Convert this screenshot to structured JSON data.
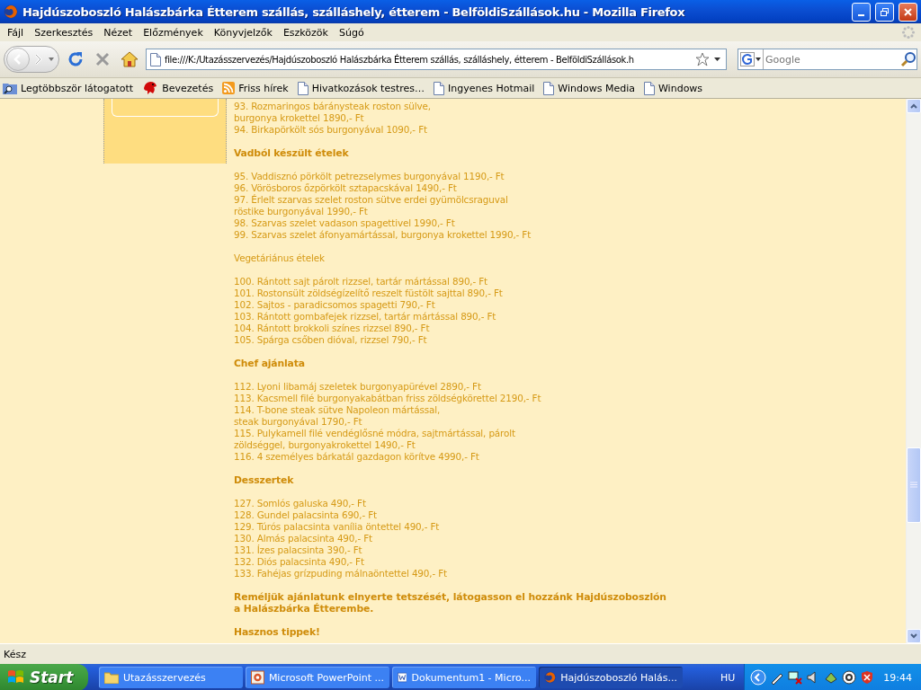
{
  "window": {
    "title": "Hajdúszoboszló Halászbárka Étterem szállás, szálláshely, étterem - BelföldiSzállások.hu - Mozilla Firefox"
  },
  "menu": [
    "Fájl",
    "Szerkesztés",
    "Nézet",
    "Előzmények",
    "Könyvjelzők",
    "Eszközök",
    "Súgó"
  ],
  "toolbar": {
    "url": "file:///K:/Utazásszervezés/Hajdúszoboszló Halászbárka Étterem szállás, szálláshely, étterem - BelföldiSzállások.h",
    "search": {
      "placeholder": "Google"
    }
  },
  "bookmarks": [
    {
      "label": "Legtöbbször látogatott",
      "kind": "smart"
    },
    {
      "label": "Bevezetés",
      "kind": "logo"
    },
    {
      "label": "Friss hírek",
      "kind": "rss"
    },
    {
      "label": "Hivatkozások testres…",
      "kind": "page"
    },
    {
      "label": "Ingyenes Hotmail",
      "kind": "page"
    },
    {
      "label": "Windows Media",
      "kind": "page"
    },
    {
      "label": "Windows",
      "kind": "page"
    }
  ],
  "content": [
    {
      "kind": "list",
      "entries": [
        [
          "93. Rozmaringos báránysteak roston sülve,",
          "burgonya krokettel 1890,- Ft"
        ],
        [
          "94. Birkapörkölt sós burgonyával 1090,- Ft"
        ]
      ]
    },
    {
      "kind": "heading",
      "text": "Vadból készült ételek"
    },
    {
      "kind": "list",
      "entries": [
        [
          "95. Vaddisznó pörkölt petrezselymes burgonyával 1190,- Ft"
        ],
        [
          "96. Vörösboros őzpörkölt sztapacskával 1490,- Ft"
        ],
        [
          "97. Érlelt szarvas szelet roston sütve erdei gyümölcsraguval",
          "röstike burgonyával 1990,- Ft"
        ],
        [
          "98. Szarvas szelet vadason spagettivel 1990,- Ft"
        ],
        [
          "99. Szarvas szelet áfonyamártással, burgonya krokettel 1990,- Ft"
        ]
      ]
    },
    {
      "kind": "subheading",
      "text": "Vegetáriánus ételek"
    },
    {
      "kind": "list",
      "entries": [
        [
          "100. Rántott sajt párolt rizzsel, tartár mártással 890,- Ft"
        ],
        [
          "101. Rostonsült zöldségízelítő reszelt füstölt sajttal 890,- Ft"
        ],
        [
          "102. Sajtos - paradicsomos spagetti 790,- Ft"
        ],
        [
          "103. Rántott gombafejek rizzsel, tartár mártással 890,- Ft"
        ],
        [
          "104. Rántott brokkoli színes rizzsel 890,- Ft"
        ],
        [
          "105. Spárga csőben dióval, rizzsel 790,- Ft"
        ]
      ]
    },
    {
      "kind": "heading",
      "text": "Chef ajánlata"
    },
    {
      "kind": "list",
      "entries": [
        [
          "112. Lyoni libamáj szeletek burgonyapürével 2890,- Ft"
        ],
        [
          "113. Kacsmell filé burgonyakabátban friss zöldségkörettel 2190,- Ft"
        ],
        [
          "114. T-bone steak sütve Napoleon mártással,",
          "steak burgonyával 1790,- Ft"
        ],
        [
          "115. Pulykamell filé vendéglősné módra, sajtmártással, párolt",
          "zöldséggel, burgonyakrokettel 1490,- Ft"
        ],
        [
          "116. 4 személyes bárkatál gazdagon körítve 4990,- Ft"
        ]
      ]
    },
    {
      "kind": "heading",
      "text": "Desszertek"
    },
    {
      "kind": "list",
      "entries": [
        [
          "127. Somlós galuska 490,- Ft"
        ],
        [
          "128. Gundel palacsinta 690,- Ft"
        ],
        [
          "129. Túrós palacsinta vanília öntettel 490,- Ft"
        ],
        [
          "130. Almás palacsinta 490,- Ft"
        ],
        [
          "131. Ízes palacsinta 390,- Ft"
        ],
        [
          "132. Diós palacsinta 490,- Ft"
        ],
        [
          "133. Fahéjas grízpuding málnaöntettel 490,- Ft"
        ]
      ]
    },
    {
      "kind": "note",
      "lines": [
        "Reméljük ajánlatunk elnyerte tetszését, látogasson el hozzánk Hajdúszoboszlón",
        "a Halászbárka Étterembe."
      ]
    },
    {
      "kind": "heading",
      "text": "Hasznos tippek!"
    }
  ],
  "status": "Kész",
  "taskbar": {
    "start": "Start",
    "tasks": [
      {
        "label": "Utazásszervezés",
        "kind": "folder",
        "selected": false
      },
      {
        "label": "Microsoft PowerPoint ...",
        "kind": "powerpoint",
        "selected": false
      },
      {
        "label": "Dokumentum1 - Micro...",
        "kind": "word",
        "selected": false
      },
      {
        "label": "Hajdúszoboszló Halás...",
        "kind": "firefox",
        "selected": true
      }
    ],
    "language": "HU",
    "clock": "19:44"
  }
}
